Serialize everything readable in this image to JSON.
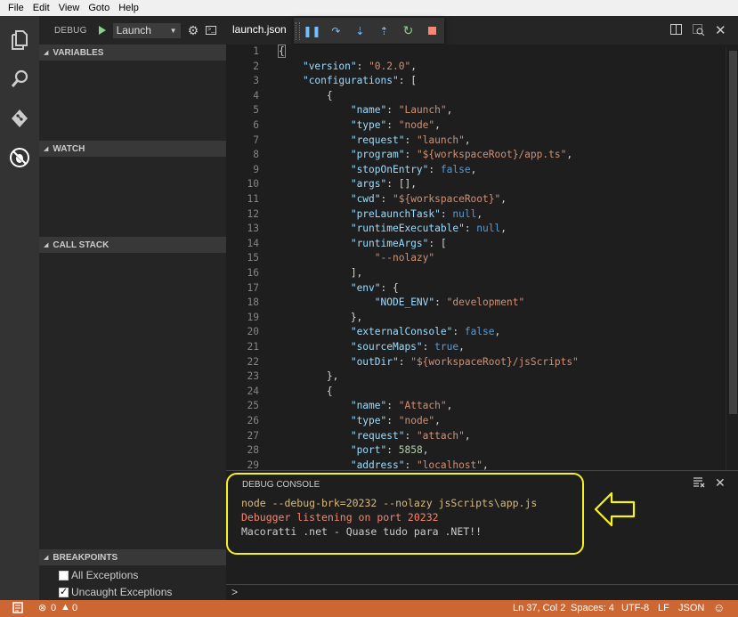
{
  "menu": [
    "File",
    "Edit",
    "View",
    "Goto",
    "Help"
  ],
  "activity": {
    "items": [
      {
        "icon": "files-icon"
      },
      {
        "icon": "search-icon"
      },
      {
        "icon": "git-icon"
      },
      {
        "icon": "debug-icon"
      }
    ]
  },
  "sidebar": {
    "title": "DEBUG",
    "config_select": "Launch",
    "sections": {
      "variables": "VARIABLES",
      "watch": "WATCH",
      "call_stack": "CALL STACK",
      "breakpoints": "BREAKPOINTS"
    },
    "breakpoints": [
      {
        "label": "All Exceptions",
        "checked": false
      },
      {
        "label": "Uncaught Exceptions",
        "checked": true
      }
    ]
  },
  "editor": {
    "tab": "launch.json",
    "lines": [
      [
        [
          "p",
          "{"
        ]
      ],
      [
        [
          "p",
          "    "
        ],
        [
          "k",
          "\"version\""
        ],
        [
          "p",
          ": "
        ],
        [
          "s",
          "\"0.2.0\""
        ],
        [
          "p",
          ","
        ]
      ],
      [
        [
          "p",
          "    "
        ],
        [
          "k",
          "\"configurations\""
        ],
        [
          "p",
          ": ["
        ]
      ],
      [
        [
          "p",
          "        {"
        ]
      ],
      [
        [
          "p",
          "            "
        ],
        [
          "k",
          "\"name\""
        ],
        [
          "p",
          ": "
        ],
        [
          "s",
          "\"Launch\""
        ],
        [
          "p",
          ","
        ]
      ],
      [
        [
          "p",
          "            "
        ],
        [
          "k",
          "\"type\""
        ],
        [
          "p",
          ": "
        ],
        [
          "s",
          "\"node\""
        ],
        [
          "p",
          ","
        ]
      ],
      [
        [
          "p",
          "            "
        ],
        [
          "k",
          "\"request\""
        ],
        [
          "p",
          ": "
        ],
        [
          "s",
          "\"launch\""
        ],
        [
          "p",
          ","
        ]
      ],
      [
        [
          "p",
          "            "
        ],
        [
          "k",
          "\"program\""
        ],
        [
          "p",
          ": "
        ],
        [
          "s",
          "\"${workspaceRoot}/app.ts\""
        ],
        [
          "p",
          ","
        ]
      ],
      [
        [
          "p",
          "            "
        ],
        [
          "k",
          "\"stopOnEntry\""
        ],
        [
          "p",
          ": "
        ],
        [
          "b",
          "false"
        ],
        [
          "p",
          ","
        ]
      ],
      [
        [
          "p",
          "            "
        ],
        [
          "k",
          "\"args\""
        ],
        [
          "p",
          ": [],"
        ]
      ],
      [
        [
          "p",
          "            "
        ],
        [
          "k",
          "\"cwd\""
        ],
        [
          "p",
          ": "
        ],
        [
          "s",
          "\"${workspaceRoot}\""
        ],
        [
          "p",
          ","
        ]
      ],
      [
        [
          "p",
          "            "
        ],
        [
          "k",
          "\"preLaunchTask\""
        ],
        [
          "p",
          ": "
        ],
        [
          "b",
          "null"
        ],
        [
          "p",
          ","
        ]
      ],
      [
        [
          "p",
          "            "
        ],
        [
          "k",
          "\"runtimeExecutable\""
        ],
        [
          "p",
          ": "
        ],
        [
          "b",
          "null"
        ],
        [
          "p",
          ","
        ]
      ],
      [
        [
          "p",
          "            "
        ],
        [
          "k",
          "\"runtimeArgs\""
        ],
        [
          "p",
          ": ["
        ]
      ],
      [
        [
          "p",
          "                "
        ],
        [
          "s",
          "\"--nolazy\""
        ]
      ],
      [
        [
          "p",
          "            ],"
        ]
      ],
      [
        [
          "p",
          "            "
        ],
        [
          "k",
          "\"env\""
        ],
        [
          "p",
          ": {"
        ]
      ],
      [
        [
          "p",
          "                "
        ],
        [
          "k",
          "\"NODE_ENV\""
        ],
        [
          "p",
          ": "
        ],
        [
          "s",
          "\"development\""
        ]
      ],
      [
        [
          "p",
          "            },"
        ]
      ],
      [
        [
          "p",
          "            "
        ],
        [
          "k",
          "\"externalConsole\""
        ],
        [
          "p",
          ": "
        ],
        [
          "b",
          "false"
        ],
        [
          "p",
          ","
        ]
      ],
      [
        [
          "p",
          "            "
        ],
        [
          "k",
          "\"sourceMaps\""
        ],
        [
          "p",
          ": "
        ],
        [
          "b",
          "true"
        ],
        [
          "p",
          ","
        ]
      ],
      [
        [
          "p",
          "            "
        ],
        [
          "k",
          "\"outDir\""
        ],
        [
          "p",
          ": "
        ],
        [
          "s",
          "\"${workspaceRoot}/jsScripts\""
        ]
      ],
      [
        [
          "p",
          "        },"
        ]
      ],
      [
        [
          "p",
          "        {"
        ]
      ],
      [
        [
          "p",
          "            "
        ],
        [
          "k",
          "\"name\""
        ],
        [
          "p",
          ": "
        ],
        [
          "s",
          "\"Attach\""
        ],
        [
          "p",
          ","
        ]
      ],
      [
        [
          "p",
          "            "
        ],
        [
          "k",
          "\"type\""
        ],
        [
          "p",
          ": "
        ],
        [
          "s",
          "\"node\""
        ],
        [
          "p",
          ","
        ]
      ],
      [
        [
          "p",
          "            "
        ],
        [
          "k",
          "\"request\""
        ],
        [
          "p",
          ": "
        ],
        [
          "s",
          "\"attach\""
        ],
        [
          "p",
          ","
        ]
      ],
      [
        [
          "p",
          "            "
        ],
        [
          "k",
          "\"port\""
        ],
        [
          "p",
          ": "
        ],
        [
          "n",
          "5858"
        ],
        [
          "p",
          ","
        ]
      ],
      [
        [
          "p",
          "            "
        ],
        [
          "k",
          "\"address\""
        ],
        [
          "p",
          ": "
        ],
        [
          "s",
          "\"localhost\""
        ],
        [
          "p",
          ","
        ]
      ]
    ]
  },
  "console": {
    "title": "DEBUG CONSOLE",
    "lines": [
      {
        "text": "node --debug-brk=20232 --nolazy jsScripts\\app.js",
        "color": "#d7ba7d"
      },
      {
        "text": "Debugger listening on port 20232",
        "color": "#f48771"
      },
      {
        "text": "Macoratti .net - Quase tudo para .NET!!",
        "color": "#cccccc"
      }
    ],
    "prompt": ">"
  },
  "status": {
    "errors": "0",
    "warnings": "0",
    "position": "Ln 37, Col 2",
    "spaces": "Spaces: 4",
    "encoding": "UTF-8",
    "eol": "LF",
    "language": "JSON"
  },
  "colors": {
    "status_bar": "#cc6633",
    "highlight": "#f7f31f"
  }
}
